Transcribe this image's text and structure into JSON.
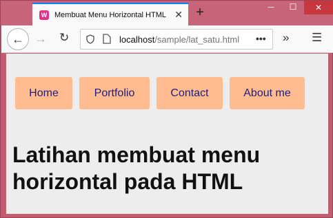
{
  "browser": {
    "tab_title": "Membuat Menu Horizontal HTML",
    "favicon_letter": "W",
    "url_host": "localhost",
    "url_path": "/sample/lat_satu.html",
    "url_more": "•••",
    "new_tab": "+",
    "close_tab": "✕"
  },
  "page": {
    "menu": [
      {
        "label": "Home"
      },
      {
        "label": "Portfolio"
      },
      {
        "label": "Contact"
      },
      {
        "label": "About me"
      }
    ],
    "heading": "Latihan membuat menu horizontal pada HTML"
  },
  "colors": {
    "menu_bg": "#ffbc91",
    "menu_text": "#1f1d7a",
    "page_bg": "#ededed",
    "window_frame": "#c25d70"
  }
}
